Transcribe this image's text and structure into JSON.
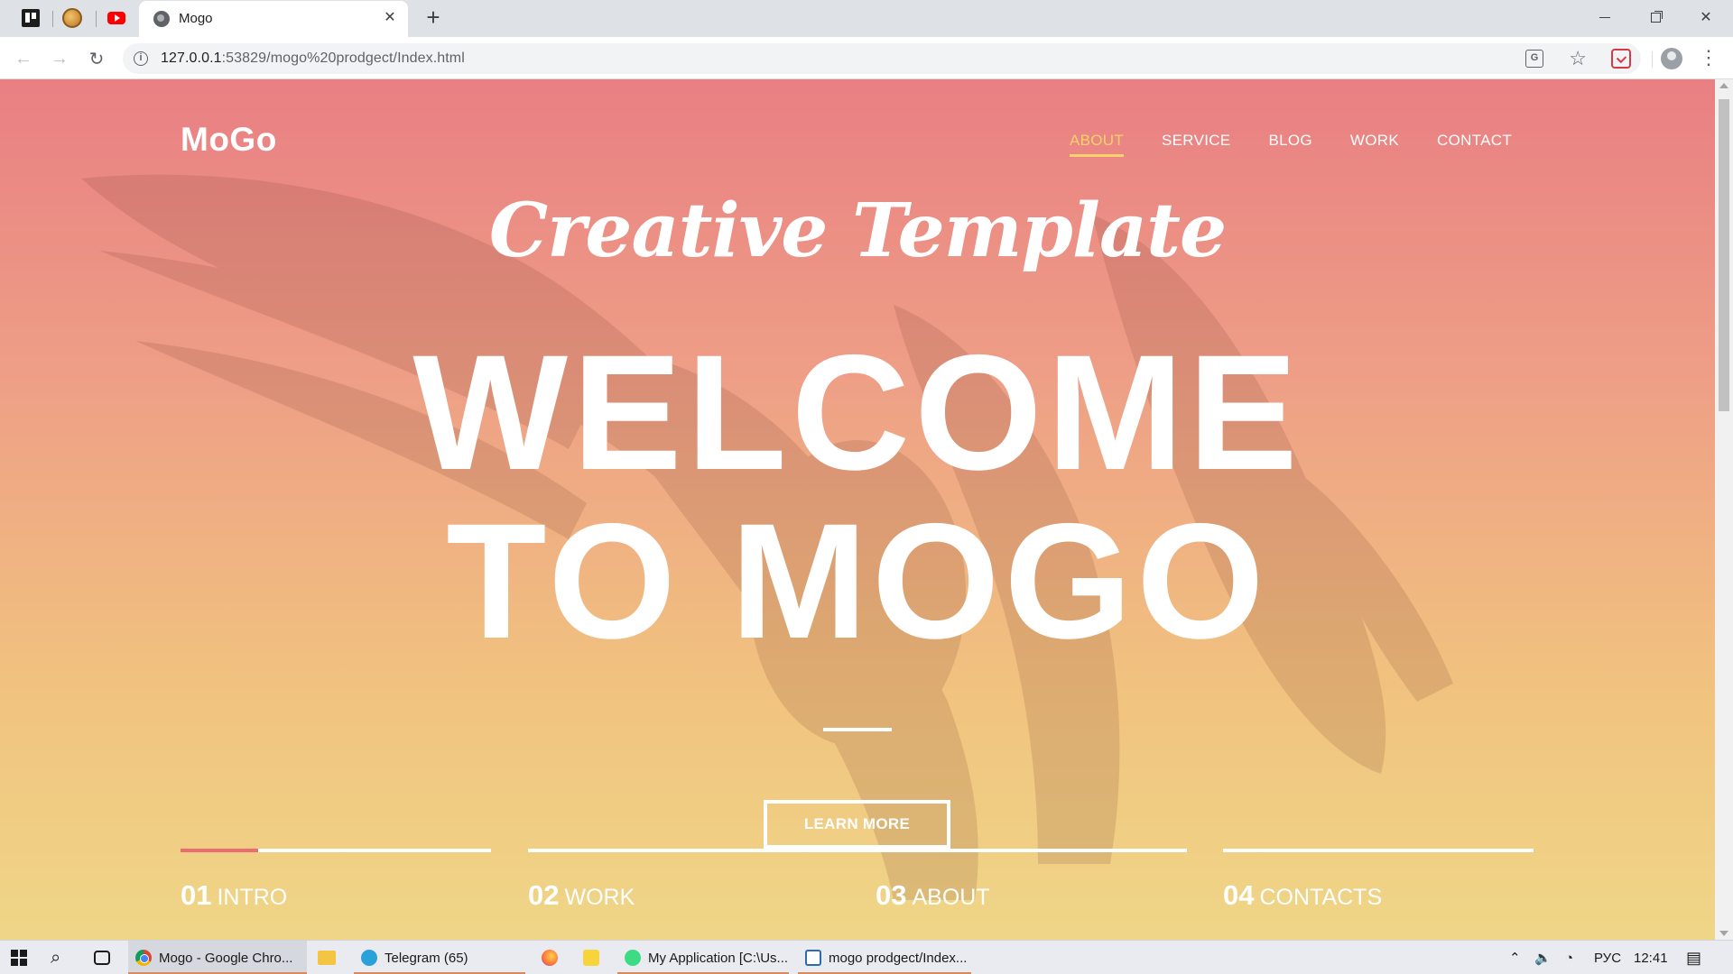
{
  "browser": {
    "tab_title": "Mogo",
    "tab_close": "✕",
    "new_tab": "+",
    "url_host": "127.0.0.1",
    "url_rest": ":53829/mogo%20prodgect/Index.html"
  },
  "page": {
    "logo": "MoGo",
    "nav": [
      {
        "label": "About",
        "active": true
      },
      {
        "label": "Service"
      },
      {
        "label": "Blog"
      },
      {
        "label": "Work"
      },
      {
        "label": "Contact"
      }
    ],
    "tagline": "Creative Template",
    "headline_1": "WELCOME",
    "headline_2": "TO MOGO",
    "cta": "LEARN MORE",
    "slides": [
      {
        "num": "01",
        "label": "INTRO",
        "progress": 0.25
      },
      {
        "num": "02",
        "label": "WORK",
        "progress": 0
      },
      {
        "num": "03",
        "label": "ABOUT",
        "progress": 0
      },
      {
        "num": "04",
        "label": "CONTACTS",
        "progress": 0
      }
    ],
    "colors": {
      "gradient_top": "#e97f83",
      "gradient_bottom": "#efd687",
      "nav_active": "#f7d26b",
      "slide_progress": "#ec6c73"
    }
  },
  "taskbar": {
    "apps": [
      {
        "label": "Mogo - Google Chro...",
        "icon": "chrome-icon"
      },
      {
        "label": "Telegram (65)",
        "icon": "telegram-icon"
      },
      {
        "label": "My Application [C:\\Us...",
        "icon": "android-studio-icon"
      },
      {
        "label": "mogo prodgect/Index...",
        "icon": "brackets-icon"
      }
    ],
    "lang": "РУС",
    "time": "12:41"
  }
}
